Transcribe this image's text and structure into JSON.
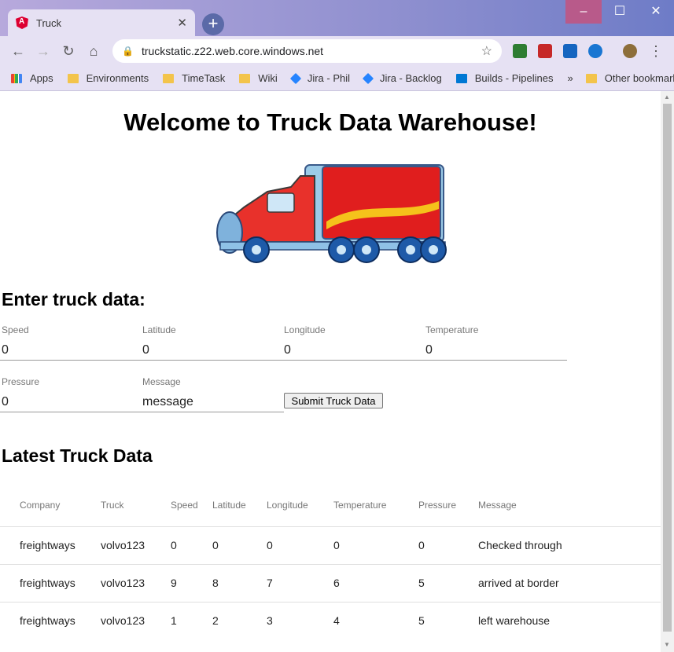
{
  "browser": {
    "tab_title": "Truck",
    "url": "truckstatic.z22.web.core.windows.net",
    "bookmarks": [
      "Apps",
      "Environments",
      "TimeTask",
      "Wiki",
      "Jira - Phil",
      "Jira - Backlog",
      "Builds - Pipelines"
    ],
    "other_bookmarks": "Other bookmarks",
    "more": "»",
    "new_tab": "+"
  },
  "page": {
    "title": "Welcome to Truck Data Warehouse!",
    "form_heading": "Enter truck data:",
    "fields": [
      {
        "label": "Speed",
        "value": "0"
      },
      {
        "label": "Latitude",
        "value": "0"
      },
      {
        "label": "Longitude",
        "value": "0"
      },
      {
        "label": "Temperature",
        "value": "0"
      },
      {
        "label": "Pressure",
        "value": "0"
      },
      {
        "label": "Message",
        "value": "message"
      }
    ],
    "submit_label": "Submit Truck Data",
    "table_heading": "Latest Truck Data",
    "columns": [
      "Company",
      "Truck",
      "Speed",
      "Latitude",
      "Longitude",
      "Temperature",
      "Pressure",
      "Message"
    ],
    "rows": [
      [
        "freightways",
        "volvo123",
        "0",
        "0",
        "0",
        "0",
        "0",
        "Checked through"
      ],
      [
        "freightways",
        "volvo123",
        "9",
        "8",
        "7",
        "6",
        "5",
        "arrived at border"
      ],
      [
        "freightways",
        "volvo123",
        "1",
        "2",
        "3",
        "4",
        "5",
        "left warehouse"
      ]
    ]
  }
}
